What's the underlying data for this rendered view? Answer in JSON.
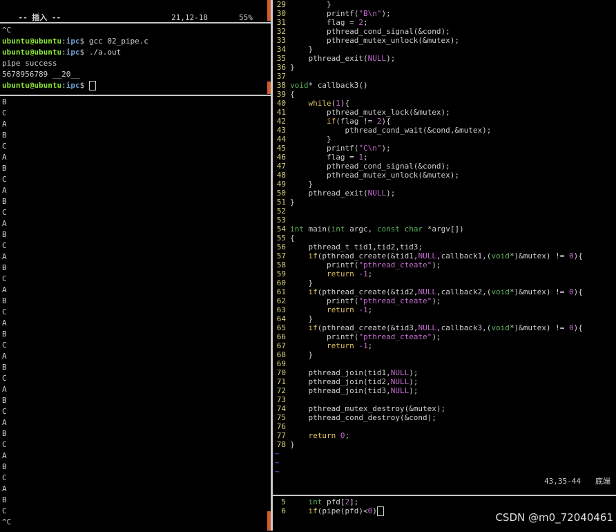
{
  "left_top": {
    "mode": "-- 插入 --",
    "position": "21,12-18",
    "percent": "55%"
  },
  "terminal": {
    "lines": [
      {
        "type": "plain",
        "text": "^C"
      },
      {
        "type": "prompt",
        "user": "ubuntu@ubuntu",
        "path": "ipc",
        "cmd": "$ gcc 02_pipe.c"
      },
      {
        "type": "prompt",
        "user": "ubuntu@ubuntu",
        "path": "ipc",
        "cmd": "$ ./a.out"
      },
      {
        "type": "plain",
        "text": "pipe success"
      },
      {
        "type": "plain",
        "text": "5678956789 __20__"
      },
      {
        "type": "prompt",
        "user": "ubuntu@ubuntu",
        "path": "ipc",
        "cmd": "$ ",
        "cursor": true
      }
    ]
  },
  "output_letters": [
    "B",
    "C",
    "A",
    "B",
    "C",
    "A",
    "B",
    "C",
    "A",
    "B",
    "C",
    "A",
    "B",
    "C",
    "A",
    "B",
    "C",
    "A",
    "B",
    "C",
    "A",
    "B",
    "C",
    "A",
    "B",
    "C",
    "A",
    "B",
    "C",
    "A",
    "B",
    "C",
    "A",
    "B",
    "C",
    "A",
    "B",
    "C"
  ],
  "output_tail": "^C",
  "code": [
    {
      "n": "29",
      "html": "        }"
    },
    {
      "n": "30",
      "html": "        printf(<span class='str'>\"B\\n\"</span>);"
    },
    {
      "n": "31",
      "html": "        flag = <span class='str'>2</span>;"
    },
    {
      "n": "32",
      "html": "        pthread_cond_signal(&amp;cond);"
    },
    {
      "n": "33",
      "html": "        pthread_mutex_unlock(&amp;mutex);"
    },
    {
      "n": "34",
      "html": "    }"
    },
    {
      "n": "35",
      "html": "    pthread_exit(<span class='nul'>NULL</span>);"
    },
    {
      "n": "36",
      "html": "}"
    },
    {
      "n": "37",
      "html": ""
    },
    {
      "n": "38",
      "html": "<span class='ty'>void</span>* callback3()"
    },
    {
      "n": "39",
      "html": "{"
    },
    {
      "n": "40",
      "html": "    <span class='kw'>while</span>(<span class='str'>1</span>){"
    },
    {
      "n": "41",
      "html": "        pthread_mutex_lock(&amp;mutex);"
    },
    {
      "n": "42",
      "html": "        <span class='kw'>if</span>(flag != <span class='str'>2</span>){"
    },
    {
      "n": "43",
      "html": "            pthread_cond_wait(&amp;cond,&amp;mutex);"
    },
    {
      "n": "44",
      "html": "        }"
    },
    {
      "n": "45",
      "html": "        printf(<span class='str'>\"C\\n\"</span>);"
    },
    {
      "n": "46",
      "html": "        flag = <span class='str'>1</span>;"
    },
    {
      "n": "47",
      "html": "        pthread_cond_signal(&amp;cond);"
    },
    {
      "n": "48",
      "html": "        pthread_mutex_unlock(&amp;mutex);"
    },
    {
      "n": "49",
      "html": "    }"
    },
    {
      "n": "50",
      "html": "    pthread_exit(<span class='nul'>NULL</span>);"
    },
    {
      "n": "51",
      "html": "}"
    },
    {
      "n": "52",
      "html": ""
    },
    {
      "n": "53",
      "html": ""
    },
    {
      "n": "54",
      "html": "<span class='ty'>int</span> main(<span class='ty'>int</span> argc, <span class='ty'>const char</span> *argv[])"
    },
    {
      "n": "55",
      "html": "{"
    },
    {
      "n": "56",
      "html": "    pthread_t tid1,tid2,tid3;"
    },
    {
      "n": "57",
      "html": "    <span class='kw'>if</span>(pthread_create(&amp;tid1,<span class='nul'>NULL</span>,callback1,(<span class='ty'>void</span>*)&amp;mutex) != <span class='str'>0</span>){"
    },
    {
      "n": "58",
      "html": "        printf(<span class='str'>\"pthread_cteate\"</span>);"
    },
    {
      "n": "59",
      "html": "        <span class='kw'>return</span> <span class='str'>-1</span>;"
    },
    {
      "n": "60",
      "html": "    }"
    },
    {
      "n": "61",
      "html": "    <span class='kw'>if</span>(pthread_create(&amp;tid2,<span class='nul'>NULL</span>,callback2,(<span class='ty'>void</span>*)&amp;mutex) != <span class='str'>0</span>){"
    },
    {
      "n": "62",
      "html": "        printf(<span class='str'>\"pthread_cteate\"</span>);"
    },
    {
      "n": "63",
      "html": "        <span class='kw'>return</span> <span class='str'>-1</span>;"
    },
    {
      "n": "64",
      "html": "    }"
    },
    {
      "n": "65",
      "html": "    <span class='kw'>if</span>(pthread_create(&amp;tid3,<span class='nul'>NULL</span>,callback3,(<span class='ty'>void</span>*)&amp;mutex) != <span class='str'>0</span>){"
    },
    {
      "n": "66",
      "html": "        printf(<span class='str'>\"pthread_cteate\"</span>);"
    },
    {
      "n": "67",
      "html": "        <span class='kw'>return</span> <span class='str'>-1</span>;"
    },
    {
      "n": "68",
      "html": "    }"
    },
    {
      "n": "69",
      "html": ""
    },
    {
      "n": "70",
      "html": "    pthread_join(tid1,<span class='nul'>NULL</span>);"
    },
    {
      "n": "71",
      "html": "    pthread_join(tid2,<span class='nul'>NULL</span>);"
    },
    {
      "n": "72",
      "html": "    pthread_join(tid3,<span class='nul'>NULL</span>);"
    },
    {
      "n": "73",
      "html": ""
    },
    {
      "n": "74",
      "html": "    pthread_mutex_destroy(&amp;mutex);"
    },
    {
      "n": "75",
      "html": "    pthread_cond_destroy(&amp;cond);"
    },
    {
      "n": "76",
      "html": ""
    },
    {
      "n": "77",
      "html": "    <span class='kw'>return</span> <span class='str'>0</span>;"
    },
    {
      "n": "78",
      "html": "}"
    }
  ],
  "tildes": [
    "~",
    "~",
    "~"
  ],
  "editor_status": {
    "position": "43,35-44",
    "scroll": "底端"
  },
  "bottom_code": [
    {
      "n": "5",
      "html": "    <span class='ty'>int</span> pfd[<span class='str'>2</span>];"
    },
    {
      "n": "6",
      "html": "    <span class='kw'>if</span>(pipe(pfd)&lt;<span class='str'>0</span>)"
    }
  ],
  "watermark": "CSDN @m0_72040461"
}
